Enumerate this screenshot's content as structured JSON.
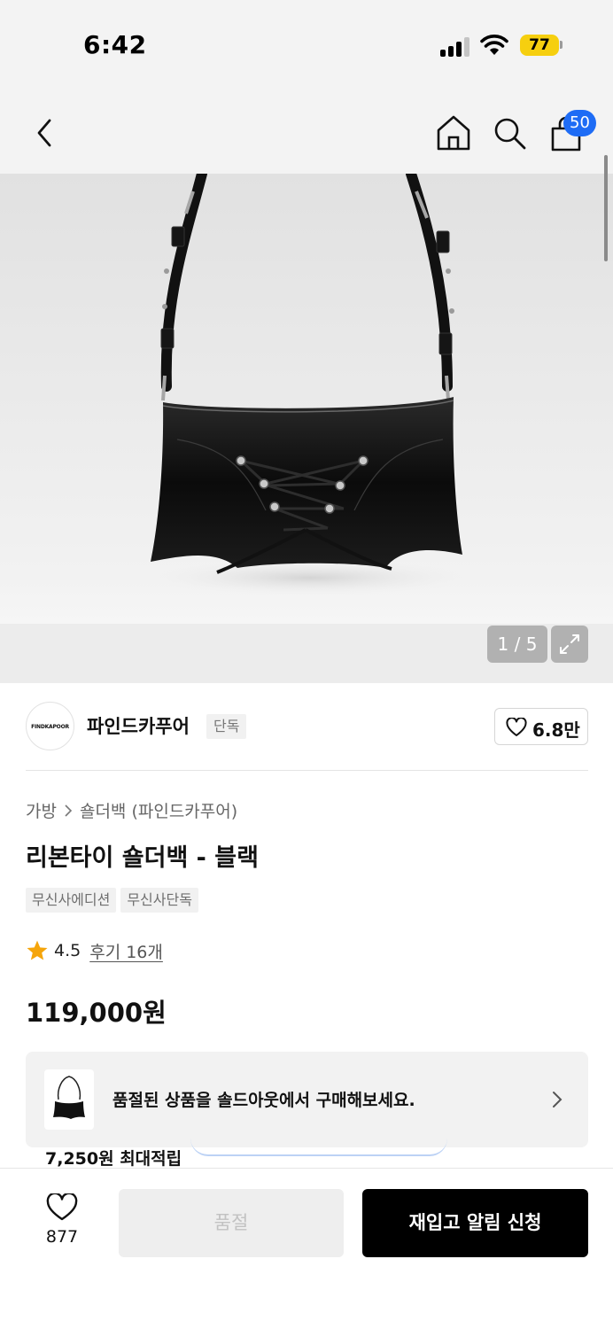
{
  "status_bar": {
    "time": "6:42",
    "battery": "77",
    "battery_color": "#f6cf0f"
  },
  "header": {
    "back_icon": "chevron-left-icon",
    "home_icon": "home-icon",
    "search_icon": "search-icon",
    "cart_icon": "shopping-bag-icon",
    "cart_count": "50",
    "badge_color": "#1e6cf5"
  },
  "gallery": {
    "pager": "1 / 5",
    "expand_icon": "expand-icon"
  },
  "brand": {
    "logo_text": "FINDKAPOOR",
    "name": "파인드카푸어",
    "exclusive_label": "단독",
    "likes": "6.8만"
  },
  "product": {
    "breadcrumb": [
      "가방",
      "숄더백 (파인드카푸어)"
    ],
    "title": "리본타이 숄더백 - 블랙",
    "tags": [
      "무신사에디션",
      "무신사단독"
    ],
    "rating": "4.5",
    "reviews": "후기 16개",
    "rating_color": "#f5a50b",
    "price": "119,000원"
  },
  "resale_banner": {
    "text": "품절된 상품을 솔드아웃에서 구매해보세요."
  },
  "points": {
    "text": "7,250원 최대적립"
  },
  "bottom_bar": {
    "wish_count": "877",
    "soldout_label": "품절",
    "restock_label": "재입고 알림 신청"
  }
}
